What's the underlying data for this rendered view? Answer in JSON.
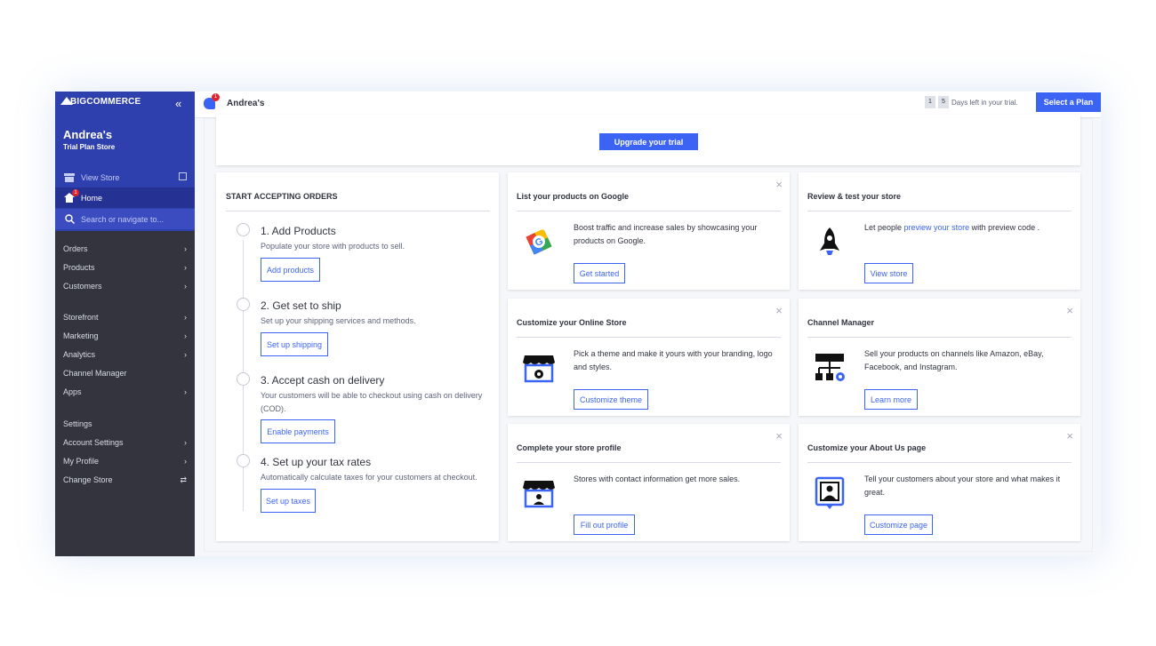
{
  "sidebar": {
    "logo": "BIGCOMMERCE",
    "store_name": "Andrea's",
    "store_plan": "Trial Plan Store",
    "view_store": "View Store",
    "home": "Home",
    "home_badge": "1",
    "search_placeholder": "Search or navigate to...",
    "nav": [
      {
        "label": "Orders",
        "chevron": "›"
      },
      {
        "label": "Products",
        "chevron": "›"
      },
      {
        "label": "Customers",
        "chevron": "›"
      },
      {
        "label": "Storefront",
        "chevron": "›"
      },
      {
        "label": "Marketing",
        "chevron": "›"
      },
      {
        "label": "Analytics",
        "chevron": "›"
      },
      {
        "label": "Channel Manager",
        "chevron": ""
      },
      {
        "label": "Apps",
        "chevron": "›"
      },
      {
        "label": "Settings",
        "chevron": ""
      },
      {
        "label": "Account Settings",
        "chevron": "›"
      },
      {
        "label": "My Profile",
        "chevron": "›"
      },
      {
        "label": "Change Store",
        "chevron": "⇄"
      }
    ]
  },
  "topbar": {
    "notification_badge": "1",
    "store_name": "Andrea's",
    "days_digit_1": "1",
    "days_digit_2": "5",
    "days_text": "Days left in your trial.",
    "select_plan": "Select a Plan"
  },
  "trial_banner": {
    "upgrade_button": "Upgrade your trial"
  },
  "orders": {
    "title": "START ACCEPTING ORDERS",
    "steps": [
      {
        "title": "1. Add Products",
        "desc": "Populate your store with products to sell.",
        "button": "Add products"
      },
      {
        "title": "2. Get set to ship",
        "desc": "Set up your shipping services and methods.",
        "button": "Set up shipping"
      },
      {
        "title": "3. Accept cash on delivery",
        "desc": "Your customers will be able to checkout using cash on delivery (COD).",
        "button": "Enable payments"
      },
      {
        "title": "4. Set up your tax rates",
        "desc": "Automatically calculate taxes for your customers at checkout.",
        "button": "Set up taxes"
      }
    ]
  },
  "cards": {
    "google": {
      "title": "List your products on Google",
      "desc": "Boost traffic and increase sales by showcasing your products on Google.",
      "button": "Get started",
      "icon": "google-tag-icon"
    },
    "review": {
      "title": "Review & test your store",
      "desc_pre": "Let people ",
      "desc_link": "preview your store",
      "desc_post": " with preview code .",
      "button": "View store",
      "icon": "rocket-icon"
    },
    "customize": {
      "title": "Customize your Online Store",
      "desc": "Pick a theme and make it yours with your branding, logo and styles.",
      "button": "Customize theme",
      "icon": "storefront-gear-icon"
    },
    "channel": {
      "title": "Channel Manager",
      "desc": "Sell your products on channels like Amazon, eBay, Facebook, and Instagram.",
      "button": "Learn more",
      "icon": "channel-network-icon"
    },
    "profile": {
      "title": "Complete your store profile",
      "desc": "Stores with contact information get more sales.",
      "button": "Fill out profile",
      "icon": "storefront-person-icon"
    },
    "about": {
      "title": "Customize your About Us page",
      "desc": "Tell your customers about your store and what makes it great.",
      "button": "Customize page",
      "icon": "person-card-icon"
    }
  },
  "colors": {
    "brand_blue": "#3c64f4",
    "sidebar_dark": "#34343f",
    "sidebar_header": "#2e3fae"
  }
}
